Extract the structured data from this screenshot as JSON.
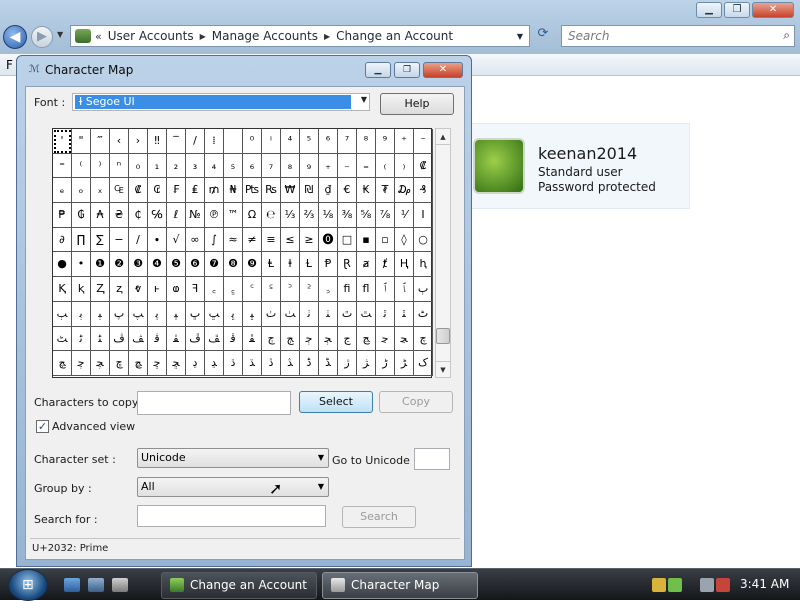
{
  "explorer": {
    "breadcrumb": [
      "User Accounts",
      "Manage Accounts",
      "Change an Account"
    ],
    "search_placeholder": "Search",
    "menu_letter": "F",
    "user": {
      "name": "keenan2014",
      "type": "Standard user",
      "password_status": "Password protected"
    }
  },
  "charmap": {
    "title": "Character Map",
    "font_label": "Font :",
    "font_value": "Segoe UI",
    "help_label": "Help",
    "grid_rows": [
      [
        "'",
        "\"",
        "‴",
        "‹",
        "›",
        "‼",
        "‾",
        "/",
        "⁞",
        "",
        "⁰",
        "ⁱ",
        "⁴",
        "⁵",
        "⁶",
        "⁷",
        "⁸",
        "⁹",
        "⁺",
        "⁻"
      ],
      [
        "⁼",
        "⁽",
        "⁾",
        "ⁿ",
        "₀",
        "₁",
        "₂",
        "₃",
        "₄",
        "₅",
        "₆",
        "₇",
        "₈",
        "₉",
        "₊",
        "₋",
        "₌",
        "₍",
        "₎",
        "₡"
      ],
      [
        "ₑ",
        "ₒ",
        "ₓ",
        "₠",
        "₡",
        "₢",
        "₣",
        "₤",
        "₥",
        "₦",
        "₧",
        "₨",
        "₩",
        "₪",
        "₫",
        "€",
        "₭",
        "₮",
        "₯",
        "₰"
      ],
      [
        "₱",
        "₲",
        "₳",
        "₴",
        "₵",
        "℅",
        "ℓ",
        "№",
        "℗",
        "™",
        "Ω",
        "℮",
        "⅓",
        "⅔",
        "⅛",
        "⅜",
        "⅝",
        "⅞",
        "⅟",
        "Ⅰ"
      ],
      [
        "∂",
        "∏",
        "∑",
        "−",
        "∕",
        "∙",
        "√",
        "∞",
        "∫",
        "≈",
        "≠",
        "≡",
        "≤",
        "≥",
        "⓿",
        "□",
        "▪",
        "▫",
        "◊",
        "○"
      ],
      [
        "●",
        "•",
        "❶",
        "❷",
        "❸",
        "❹",
        "❺",
        "❻",
        "❼",
        "❽",
        "❾",
        "Ⱡ",
        "ⱡ",
        "Ɫ",
        "Ᵽ",
        "Ɽ",
        "ⱥ",
        "ⱦ",
        "Ⱨ",
        "ⱨ"
      ],
      [
        "Ⱪ",
        "ⱪ",
        "Ⱬ",
        "ⱬ",
        "ⱴ",
        "ⱶ",
        "ⱷ",
        "ꟻ",
        "꜀",
        "꜁",
        "꜂",
        "꜃",
        "꜄",
        "꜅",
        "꜆",
        "ﬁ",
        "ﬂ",
        "ﭐ",
        "ﭑ",
        "ﭒ"
      ],
      [
        "ﭓ",
        "ﭔ",
        "ﭕ",
        "ﭖ",
        "ﭗ",
        "ﭘ",
        "ﭙ",
        "ﭚ",
        "ﭛ",
        "ﭜ",
        "ﭝ",
        "ﭞ",
        "ﭟ",
        "ﭠ",
        "ﭡ",
        "ﭢ",
        "ﭣ",
        "ﭤ",
        "ﭥ",
        "ﭦ"
      ],
      [
        "ﭧ",
        "ﭨ",
        "ﭩ",
        "ﭪ",
        "ﭫ",
        "ﭬ",
        "ﭭ",
        "ﭮ",
        "ﭯ",
        "ﭰ",
        "ﭱ",
        "ﭲ",
        "ﭳ",
        "ﭴ",
        "ﭵ",
        "ﭶ",
        "ﭷ",
        "ﭸ",
        "ﭹ",
        "ﭺ"
      ],
      [
        "ﭻ",
        "ﭼ",
        "ﭽ",
        "ﭾ",
        "ﭿ",
        "ﮀ",
        "ﮁ",
        "ﮂ",
        "ﮃ",
        "ﮄ",
        "ﮅ",
        "ﮆ",
        "ﮇ",
        "ﮈ",
        "ﮉ",
        "ﮊ",
        "ﮋ",
        "ﮌ",
        "ﮍ",
        "ﮎ"
      ]
    ],
    "chars_to_copy_label": "Characters to copy",
    "chars_to_copy_value": "",
    "select_label": "Select",
    "copy_label": "Copy",
    "advanced_view_label": "Advanced view",
    "advanced_view_checked": true,
    "charset_label": "Character set :",
    "charset_value": "Unicode",
    "goto_unicode_label": "Go to Unicode :",
    "groupby_label": "Group by :",
    "groupby_value": "All",
    "searchfor_label": "Search for :",
    "search_button_label": "Search",
    "status_text": "U+2032: Prime"
  },
  "taskbar": {
    "tasks": [
      {
        "label": "Change an Account"
      },
      {
        "label": "Character Map"
      }
    ],
    "clock": "3:41 AM"
  }
}
